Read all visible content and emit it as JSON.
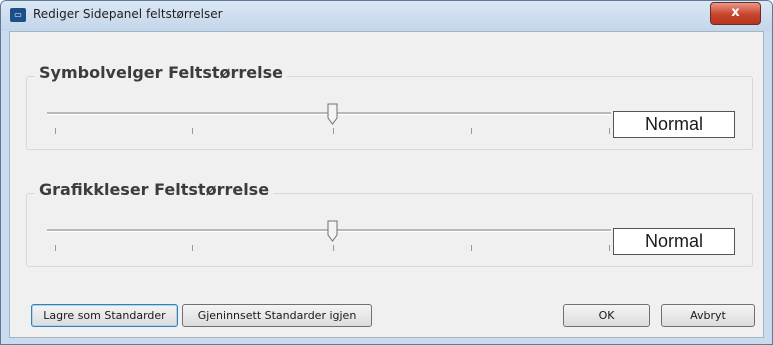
{
  "window": {
    "title": "Rediger Sidepanel feltstørrelser",
    "icon": "app-icon",
    "close_label": "x"
  },
  "groups": [
    {
      "title": "Symbolvelger Feltstørrelse",
      "value_label": "Normal",
      "slider_position": 0.5,
      "tick_count": 5
    },
    {
      "title": "Grafikkleser Feltstørrelse",
      "value_label": "Normal",
      "slider_position": 0.5,
      "tick_count": 5
    }
  ],
  "buttons": {
    "save_defaults": "Lagre som Standarder",
    "restore_defaults": "Gjeninnsett Standarder igjen",
    "ok": "OK",
    "cancel": "Avbryt"
  }
}
